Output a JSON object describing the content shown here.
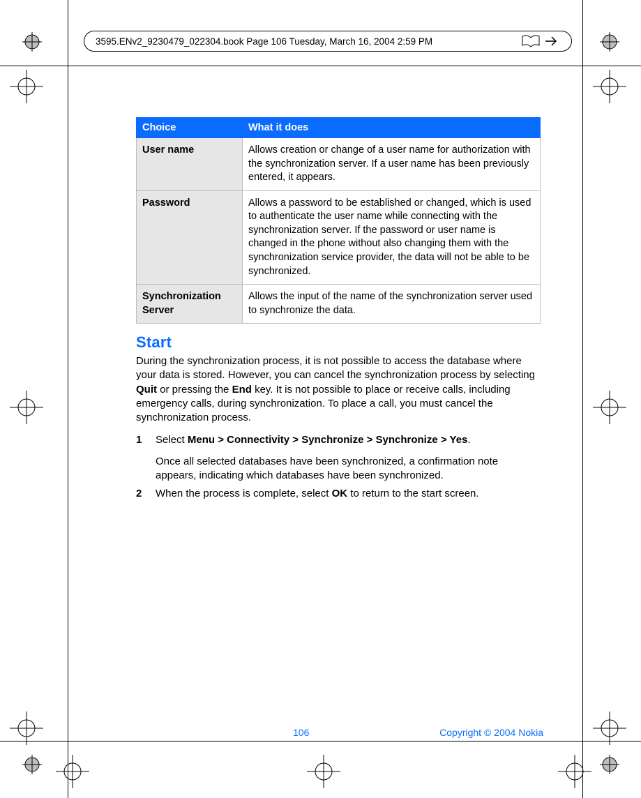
{
  "header": {
    "text": "3595.ENv2_9230479_022304.book  Page 106  Tuesday, March 16, 2004  2:59 PM"
  },
  "table": {
    "headers": {
      "choice": "Choice",
      "what": "What it does"
    },
    "rows": [
      {
        "choice": "User name",
        "what": "Allows creation or change of a user name for authorization with the synchronization server. If a user name has been previously entered, it appears."
      },
      {
        "choice": "Password",
        "what": "Allows a password to be established or changed, which is used to authenticate the user name while connecting with the synchronization server. If the password or user name is changed in the phone without also changing them with the synchronization service provider, the data will not be able to be synchronized."
      },
      {
        "choice": "Synchronization Server",
        "what": "Allows the input of the name of the synchronization server used to synchronize the data."
      }
    ]
  },
  "section": {
    "title": "Start",
    "para_parts": {
      "p1": "During the synchronization process, it is not possible to access the database where your data is stored. However, you can cancel the synchronization process by selecting ",
      "b1": "Quit",
      "p2": " or pressing the ",
      "b2": "End",
      "p3": " key. It is not possible to place or receive calls, including emergency calls, during synchronization. To place a call, you must cancel the synchronization process."
    },
    "steps": {
      "s1": {
        "num": "1",
        "lead": "Select ",
        "bold": "Menu > Connectivity > Synchronize > Synchronize > Yes",
        "tail": ".",
        "followup": "Once all selected databases have been synchronized, a confirmation note appears, indicating which databases have been synchronized."
      },
      "s2": {
        "num": "2",
        "lead": "When the process is complete, select ",
        "bold": "OK",
        "tail": " to return to the start screen."
      }
    }
  },
  "footer": {
    "page": "106",
    "copyright": "Copyright © 2004 Nokia"
  }
}
